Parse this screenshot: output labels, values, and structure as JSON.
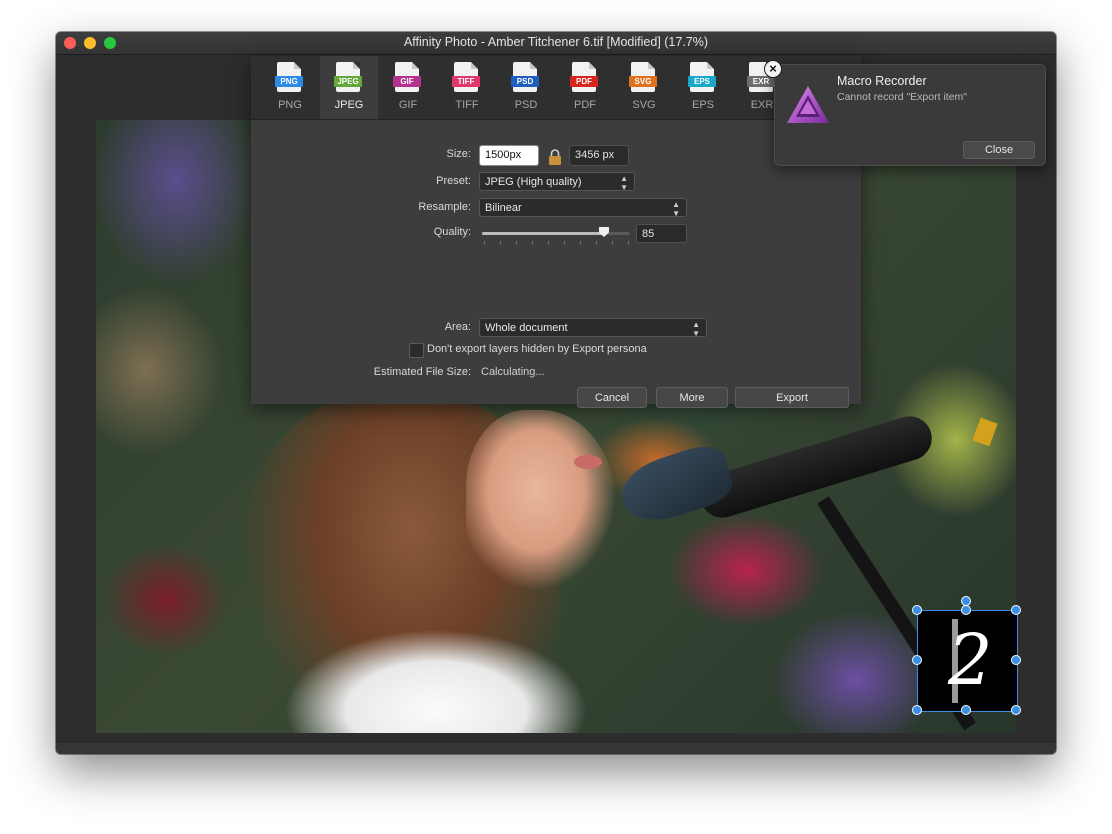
{
  "window": {
    "title": "Affinity Photo - Amber Titchener 6.tif [Modified] (17.7%)"
  },
  "formats": [
    {
      "label": "PNG",
      "tag": "PNG",
      "color": "#2d8be6",
      "active": false
    },
    {
      "label": "JPEG",
      "tag": "JPEG",
      "color": "#63a83a",
      "active": true
    },
    {
      "label": "GIF",
      "tag": "GIF",
      "color": "#b4328f",
      "active": false
    },
    {
      "label": "TIFF",
      "tag": "TIFF",
      "color": "#e0386d",
      "active": false
    },
    {
      "label": "PSD",
      "tag": "PSD",
      "color": "#1e5fbf",
      "active": false
    },
    {
      "label": "PDF",
      "tag": "PDF",
      "color": "#d7261f",
      "active": false
    },
    {
      "label": "SVG",
      "tag": "SVG",
      "color": "#e0721f",
      "active": false
    },
    {
      "label": "EPS",
      "tag": "EPS",
      "color": "#1aa6c9",
      "active": false
    },
    {
      "label": "EXR",
      "tag": "EXR",
      "color": "#6e6e6e",
      "active": false
    }
  ],
  "export": {
    "size_label": "Size:",
    "width_value": "1500px",
    "height_value": "3456 px",
    "preset_label": "Preset:",
    "preset_value": "JPEG (High quality)",
    "resample_label": "Resample:",
    "resample_value": "Bilinear",
    "quality_label": "Quality:",
    "quality_value": "85",
    "area_label": "Area:",
    "area_value": "Whole document",
    "hidden_layers_label": "Don't export layers hidden by Export persona",
    "file_size_label": "Estimated File Size:",
    "file_size_value": "Calculating...",
    "cancel_label": "Cancel",
    "more_label": "More",
    "export_label": "Export"
  },
  "notification": {
    "title": "Macro Recorder",
    "message": "Cannot record \"Export item\"",
    "close_label": "Close"
  },
  "colors": {
    "selection": "#3a8ee6",
    "accent_purple": "#b83ccf"
  }
}
